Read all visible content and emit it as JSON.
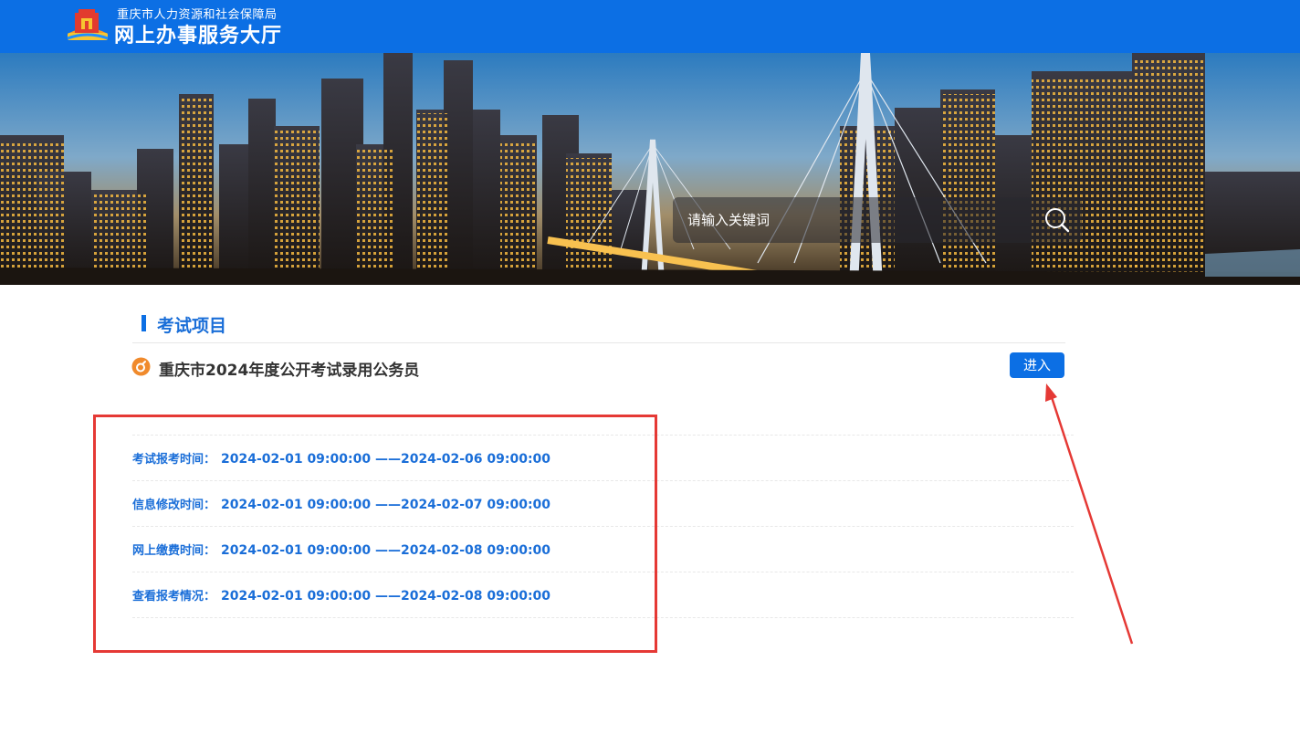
{
  "header": {
    "subtitle": "重庆市人力资源和社会保障局",
    "title": "网上办事服务大厅"
  },
  "search": {
    "placeholder": "请输入关键词"
  },
  "section": {
    "title": "考试项目"
  },
  "exam": {
    "title": "重庆市2024年度公开考试录用公务员",
    "enter_label": "进入",
    "schedule": [
      {
        "label": "考试报考时间：",
        "value": "2024-02-01 09:00:00 ——2024-02-06 09:00:00"
      },
      {
        "label": "信息修改时间：",
        "value": "2024-02-01 09:00:00 ——2024-02-07 09:00:00"
      },
      {
        "label": "网上缴费时间：",
        "value": "2024-02-01 09:00:00 ——2024-02-08 09:00:00"
      },
      {
        "label": "查看报考情况：",
        "value": "2024-02-01 09:00:00 ——2024-02-08 09:00:00"
      }
    ]
  },
  "colors": {
    "brand_blue": "#0c6fe4",
    "text_blue": "#1a6ed8",
    "accent_orange": "#f08a2c",
    "annotation_red": "#e53935"
  },
  "icons": {
    "logo": "emblem-icon",
    "search": "search-icon",
    "item": "orange-circle-icon"
  }
}
